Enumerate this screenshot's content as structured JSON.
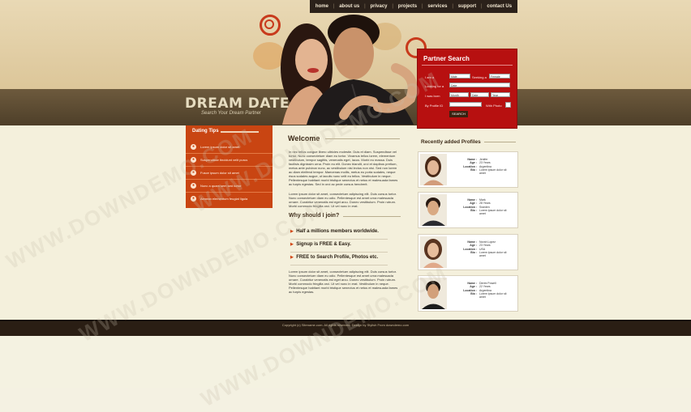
{
  "nav": {
    "items": [
      "home",
      "about us",
      "privacy",
      "projects",
      "services",
      "support",
      "contact Us"
    ]
  },
  "logo": {
    "title": "DREAM DATE",
    "subtitle": "Search Your Dream Partner"
  },
  "partner_search": {
    "title": "Partner Search",
    "rows": [
      {
        "label": "I am a",
        "select1": "Male",
        "label2": "Seeking a",
        "select2": "Female"
      },
      {
        "label": "Looking for a",
        "select1": "Date"
      },
      {
        "label": "I was born",
        "select1": "Month",
        "select2": "Date",
        "select3": "Year"
      },
      {
        "label": "By Profile ID",
        "label2": "With Photo"
      }
    ],
    "button": "SEARCH"
  },
  "dating_tips": {
    "title": "Dating Tips",
    "items": [
      "Lorem ipsum dolor sit amet",
      "Suspendisse tincidunt velit purus",
      "Fusce ipsum dolor sit amet",
      "Nunc a quam sem sed tortor",
      "Aenean elementum feugiat ligula"
    ]
  },
  "welcome": {
    "title": "Welcome",
    "para1": "In nec tellus congue libero ultricies molestie. Duis et diam. Suspendisse vel tortor. Nunc consectetuer diam eu tortor. Vivamus tellus lorem, elementum vestibulum, tempor sagittis, venenatis eget, lacus. Morbi eu massa. Duis facilisis dignissim urna. Proin eu elit. Donec blandit, orci et dapibus pretium, metus ante pulvinar nunc, ac vestibulum nisi lectus non nisi. Sed non lorem ac diam eleifend tempor. Maecenas mollis, metus eu porta sodales, neque risus sodales augue, ut iaculis nunc velit eu tellus. Vestibulum in neque. Pellentesque habitant morbi tristique senectus et netus et malesuada fames ac turpis egestas. Sed in orci ac pede cursus hendrerit.",
    "para2": "Lorem ipsum dolor sit amet, consectetuer adipiscing elit. Duis cursus tortor. Nunc consectetuer diam eu odio. Pellentesque est amet urna malesuada ornare. Curabitur venenatis est eget arcu. Donec vestibulum. Proin rutrum. Morbi commodo fringilla orci. Ut vel nunc in erat."
  },
  "why": {
    "title": "Why should I join?",
    "items": [
      "Half a millions members worldwide.",
      "Signup is FREE & Easy.",
      "FREE to Search Profile, Photos etc."
    ],
    "para": "Lorem ipsum dolor sit amet, consectetuer adipiscing elit. Duis cursus tortor. Nunc consectetuer diam eu odio. Pellentesque est amet urna malesuada ornare. Curabitur venenatis est eget arcu. Donec vestibulum. Proin rutrum. Morbi commodo fringilla orci. Ut vel nunc in erat. Vestibulum in neque. Pellentesque habitant morbi tristique senectus et netus et malesuada fames ac turpis egestas."
  },
  "recent": {
    "title": "Recently added Profiles",
    "labels": {
      "name": "Name :",
      "age": "Age :",
      "location": "Location :",
      "bio": "Bio :"
    },
    "profiles": [
      {
        "name": "Jenifer",
        "age": "23 Years",
        "location": "Argentina",
        "bio": "Lorem ipsum dolor sit amet"
      },
      {
        "name": "Mark",
        "age": "28 Years",
        "location": "Sweden",
        "bio": "Lorem ipsum dolor sit amet"
      },
      {
        "name": "Norah Lopez",
        "age": "23 Years",
        "location": "USA",
        "bio": "Lorem ipsum dolor sit amet"
      },
      {
        "name": "Derek Powell",
        "age": "22 Years",
        "location": "Argentina",
        "bio": "Lorem ipsum dolor sit amet"
      }
    ]
  },
  "footer": "Copyright (c) Sitename.com. All rights reserved. Design by Stylish From downdemo.com",
  "watermark": "WWW.DOWNDEMO.COM"
}
